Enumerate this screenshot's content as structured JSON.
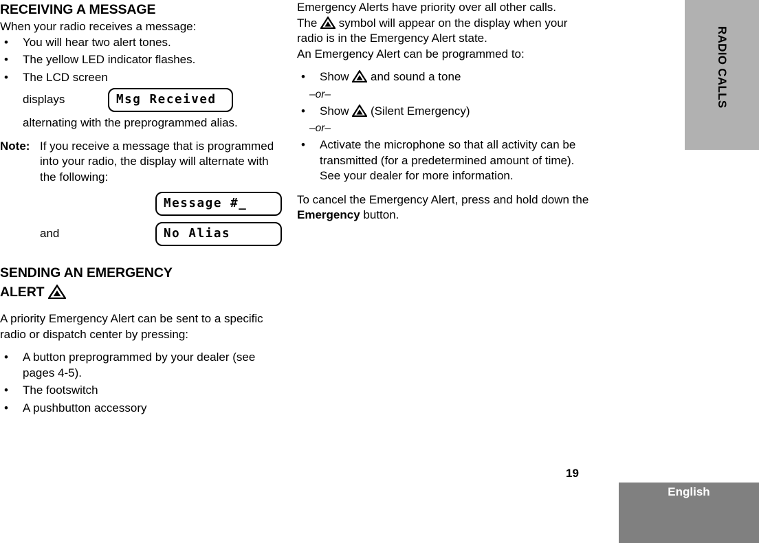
{
  "document": {
    "page_number": "19",
    "language_label": "English",
    "side_tab_label": "RADIO CALLS"
  },
  "left_column": {
    "section_title": "RECEIVING A MESSAGE",
    "intro": "When your radio receives a message:",
    "bullets": [
      "You will hear two alert tones.",
      "The yellow LED indicator flashes.",
      "The LCD screen"
    ],
    "displays_label": "displays",
    "lcd_msg_received": "Msg Received",
    "alternating_text": "alternating with the preprogrammed alias.",
    "note_label": "Note:",
    "note_body": "If you receive a message that is programmed into your radio, the display will alternate with the following:",
    "lcd_message_number": "Message #_",
    "and_label": "and",
    "lcd_no_alias": "No Alias",
    "section_title_2_line1": "SENDING AN EMERGENCY",
    "section_title_2_line2": "ALERT",
    "emergency_icon": "emergency-triangle-icon",
    "paragraph_2": "A priority Emergency Alert can be sent to a specific radio or dispatch center by pressing:",
    "bullets_2": [
      "A button preprogrammed by your dealer (see pages 4-5).",
      "The footswitch",
      "A pushbutton accessory"
    ]
  },
  "right_column": {
    "paragraph_1": "Emergency Alerts have priority over all other calls.",
    "paragraph_2_pre": "The",
    "paragraph_2_post": "symbol will appear on the display when your radio is in the Emergency Alert state.",
    "paragraph_3": "An Emergency Alert can be programmed to:",
    "bullet_1_pre": "Show",
    "bullet_1_post": "and sound a tone",
    "or_1": "–or–",
    "bullet_2_pre": "Show",
    "bullet_2_post": "(Silent Emergency)",
    "or_2": "–or–",
    "bullet_3": "Activate the microphone so that all activity can be transmitted (for a predetermined amount of time). See your dealer for more information.",
    "paragraph_4_pre": "To cancel the Emergency Alert, press and hold down the",
    "paragraph_4_bold": "Emergency",
    "paragraph_4_post": "button."
  }
}
